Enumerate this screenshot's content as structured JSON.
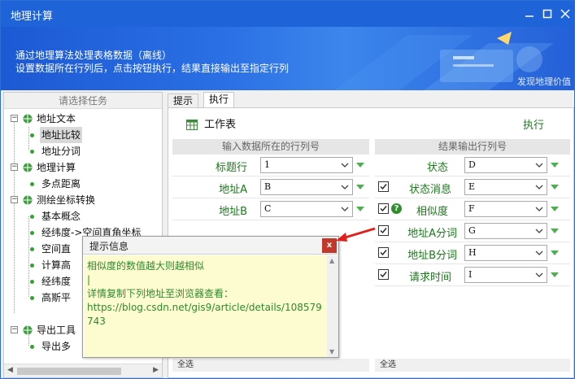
{
  "window": {
    "title": "地理计算",
    "controls": [
      "minimize",
      "maximize",
      "close"
    ]
  },
  "banner": {
    "line1": "通过地理算法处理表格数据（离线）",
    "line2": "设置数据所在行列后，点击按钮执行，结果直接输出至指定行列",
    "brand": "发现地理价值"
  },
  "left_panel": {
    "header": "请选择任务",
    "tree": [
      {
        "label": "地址文本",
        "expanded": true,
        "children": [
          {
            "label": "地址比较",
            "selected": true
          },
          {
            "label": "地址分词"
          }
        ]
      },
      {
        "label": "地理计算",
        "expanded": true,
        "children": [
          {
            "label": "多点距离"
          }
        ]
      },
      {
        "label": "测绘坐标转换",
        "expanded": true,
        "children": [
          {
            "label": "基本概念"
          },
          {
            "label": "经纬度->空间直角坐标"
          },
          {
            "label": "空间直"
          },
          {
            "label": "计算高"
          },
          {
            "label": "经纬度"
          },
          {
            "label": "高斯平"
          }
        ]
      },
      {
        "label": "导出工具",
        "expanded": true,
        "children": [
          {
            "label": "导出多"
          }
        ]
      }
    ]
  },
  "tabs": [
    "提示",
    "执行"
  ],
  "active_tab": "执行",
  "toolbar": {
    "sheet_label": "工作表",
    "execute_label": "执行"
  },
  "input_section": {
    "header": "输入数据所在的行列号",
    "rows": [
      {
        "label": "标题行",
        "value": "1"
      },
      {
        "label": "地址A",
        "value": "B"
      },
      {
        "label": "地址B",
        "value": "C"
      }
    ],
    "footer": "全选"
  },
  "output_section": {
    "header": "结果输出行列号",
    "rows": [
      {
        "label": "状态",
        "value": "D",
        "checked": false,
        "has_checkbox": false
      },
      {
        "label": "状态消息",
        "value": "E",
        "checked": true,
        "has_checkbox": true
      },
      {
        "label": "相似度",
        "value": "F",
        "checked": true,
        "has_checkbox": true,
        "help": true
      },
      {
        "label": "地址A分词",
        "value": "G",
        "checked": true,
        "has_checkbox": true
      },
      {
        "label": "地址B分词",
        "value": "H",
        "checked": true,
        "has_checkbox": true
      },
      {
        "label": "请求时间",
        "value": "I",
        "checked": true,
        "has_checkbox": true
      }
    ],
    "footer": "全选"
  },
  "popup": {
    "title": "提示信息",
    "close_label": "x",
    "line1": "相似度的数值越大则越相似",
    "line2": "详情复制下列地址至浏览器查看：",
    "line3": "https://blog.csdn.net/gis9/article/details/108579743"
  },
  "colors": {
    "titlebar": "#1f63d9",
    "label_green": "#1a7a1a",
    "popup_bg": "#fdfbd0",
    "annotation_arrow": "#e0201c"
  }
}
